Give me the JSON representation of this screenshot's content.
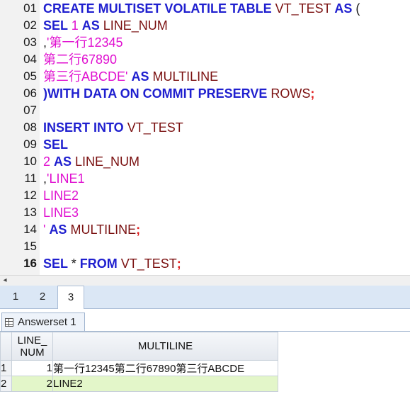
{
  "editor": {
    "lines": [
      {
        "no": "01",
        "tokens": [
          {
            "t": "CREATE MULTISET VOLATILE TABLE ",
            "c": "kw"
          },
          {
            "t": "VT_TEST ",
            "c": "id"
          },
          {
            "t": "AS",
            "c": "kw"
          },
          {
            "t": " (",
            "c": "pun"
          }
        ]
      },
      {
        "no": "02",
        "tokens": [
          {
            "t": "SEL ",
            "c": "kw"
          },
          {
            "t": "1 ",
            "c": "num"
          },
          {
            "t": "AS ",
            "c": "kw"
          },
          {
            "t": "LINE_NUM",
            "c": "id"
          }
        ]
      },
      {
        "no": "03",
        "tokens": [
          {
            "t": ",",
            "c": "pun"
          },
          {
            "t": "'第一行12345",
            "c": "str"
          }
        ]
      },
      {
        "no": "04",
        "tokens": [
          {
            "t": "第二行67890",
            "c": "str"
          }
        ]
      },
      {
        "no": "05",
        "tokens": [
          {
            "t": "第三行ABCDE' ",
            "c": "str"
          },
          {
            "t": "AS ",
            "c": "kw"
          },
          {
            "t": "MULTILINE",
            "c": "id"
          }
        ]
      },
      {
        "no": "06",
        "tokens": [
          {
            "t": ")WITH DATA ON COMMIT PRESERVE ",
            "c": "kw"
          },
          {
            "t": "ROWS",
            "c": "id"
          },
          {
            "t": ";",
            "c": "sem"
          }
        ]
      },
      {
        "no": "07",
        "tokens": []
      },
      {
        "no": "08",
        "tokens": [
          {
            "t": "INSERT INTO ",
            "c": "kw"
          },
          {
            "t": "VT_TEST",
            "c": "id"
          }
        ]
      },
      {
        "no": "09",
        "tokens": [
          {
            "t": "SEL",
            "c": "kw"
          }
        ]
      },
      {
        "no": "10",
        "tokens": [
          {
            "t": "2 ",
            "c": "num"
          },
          {
            "t": "AS ",
            "c": "kw"
          },
          {
            "t": "LINE_NUM",
            "c": "id"
          }
        ]
      },
      {
        "no": "11",
        "tokens": [
          {
            "t": ",",
            "c": "pun"
          },
          {
            "t": "'LINE1",
            "c": "str"
          }
        ]
      },
      {
        "no": "12",
        "tokens": [
          {
            "t": "LINE2",
            "c": "str"
          }
        ]
      },
      {
        "no": "13",
        "tokens": [
          {
            "t": "LINE3",
            "c": "str"
          }
        ]
      },
      {
        "no": "14",
        "tokens": [
          {
            "t": "' ",
            "c": "str"
          },
          {
            "t": "AS ",
            "c": "kw"
          },
          {
            "t": "MULTILINE",
            "c": "id"
          },
          {
            "t": ";",
            "c": "sem"
          }
        ]
      },
      {
        "no": "15",
        "tokens": []
      },
      {
        "no": "16",
        "current": true,
        "tokens": [
          {
            "t": "SEL ",
            "c": "kw"
          },
          {
            "t": "* ",
            "c": "pun"
          },
          {
            "t": "FROM ",
            "c": "kw"
          },
          {
            "t": "VT_TEST",
            "c": "id"
          },
          {
            "t": ";",
            "c": "sem"
          }
        ]
      }
    ]
  },
  "scrollbar": {
    "left_arrow": "◂"
  },
  "result_tabs": {
    "tab1": "1",
    "tab2": "2",
    "tab3": "3",
    "active": "3"
  },
  "answerset": {
    "tab_label": "Answerset 1",
    "columns": {
      "line_num_1": "LINE_",
      "line_num_2": "NUM",
      "multiline": "MULTILINE"
    },
    "rows": [
      {
        "row_no": "1",
        "line_num": "1",
        "multiline": "第一行12345第二行67890第三行ABCDE"
      },
      {
        "row_no": "2",
        "line_num": "2",
        "multiline": "LINE2"
      }
    ],
    "selected_row_color": "#e3f6c9"
  },
  "colors": {
    "keyword": "#1f1fcf",
    "identifier": "#7a1010",
    "string": "#e010d0",
    "semicolon": "#e02020"
  }
}
